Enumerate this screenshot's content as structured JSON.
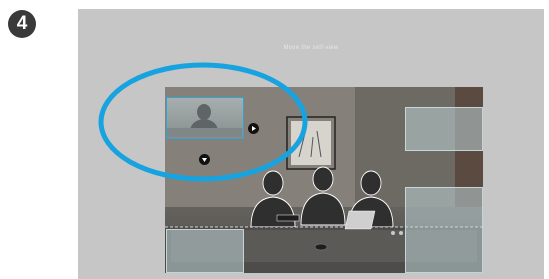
{
  "step": {
    "number": "4"
  },
  "screen": {
    "title": "Move the self-view"
  },
  "colors": {
    "screen_background": "#c6c6c6",
    "highlight": "#16a3e0",
    "selected_border": "#2ea4cf",
    "step_badge": "#3a3a3a"
  },
  "icons": {
    "move_right": "arrow-right-icon",
    "move_down": "arrow-down-icon"
  }
}
